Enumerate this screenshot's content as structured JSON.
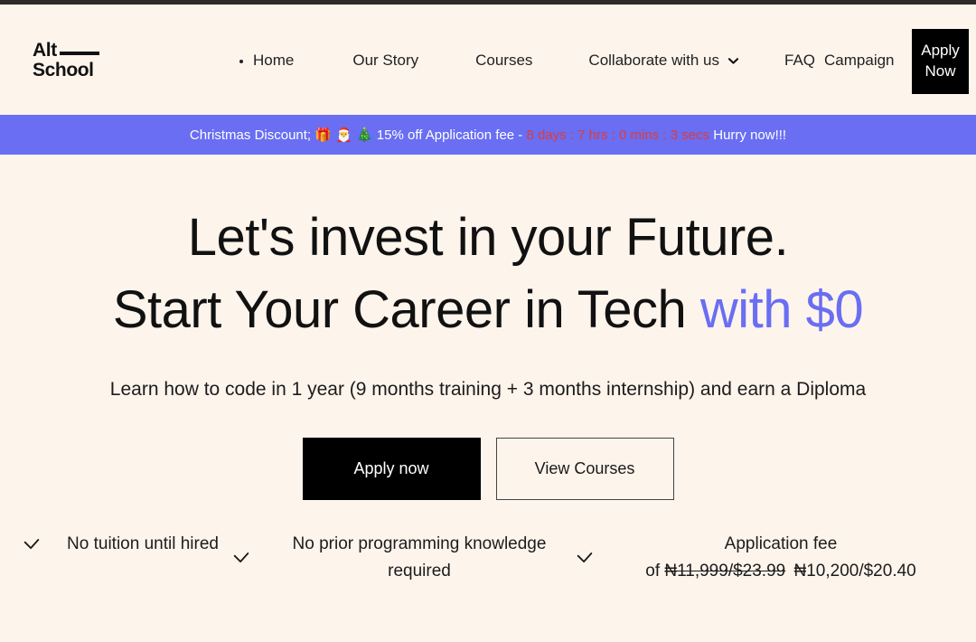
{
  "brand": {
    "line1": "Alt",
    "line2": "School"
  },
  "nav": {
    "items": [
      {
        "label": "Home",
        "icon": "bullet-marker",
        "bulleted": true
      },
      {
        "label": "Our Story",
        "bulleted": false
      },
      {
        "label": "Courses",
        "bulleted": false
      },
      {
        "label": "Collaborate with us",
        "bulleted": false,
        "icon": "chevron-down-icon",
        "has_dropdown": true
      },
      {
        "label": "FAQ",
        "bulleted": false
      },
      {
        "label": "Campaign",
        "bulleted": false
      }
    ],
    "apply_now_label": "Apply\nNow"
  },
  "promo": {
    "prefix": "Christmas Discount; 🎁 🎅 🎄 15% off Application fee - ",
    "countdown": "8 days : 7 hrs : 0 mins : 3 secs",
    "suffix": " Hurry now!!!",
    "background_color": "#696ef2",
    "countdown_color": "#e03b3b",
    "text_color": "#ffffff"
  },
  "hero": {
    "title_line1": "Let's invest in your Future.",
    "title_line2_main": "Start Your Career in Tech ",
    "title_line2_accent": "with $0",
    "accent_color": "#696ef2",
    "subtitle": "Learn how to code in 1 year (9 months training + 3 months internship) and earn a Diploma",
    "primary_cta": "Apply now",
    "secondary_cta": "View Courses"
  },
  "features": [
    {
      "icon": "check-icon",
      "text": "No tuition until hired"
    },
    {
      "icon": "check-icon",
      "text": "No prior programming knowledge required"
    },
    {
      "icon": "check-icon",
      "label": "Application fee",
      "of_word": "of",
      "old_price": "₦11,999/$23.99",
      "new_price": "₦10,200/$20.40"
    }
  ],
  "theme": {
    "page_background": "#fdf4ec",
    "top_strip": "#2e2a28",
    "black": "#000000"
  }
}
